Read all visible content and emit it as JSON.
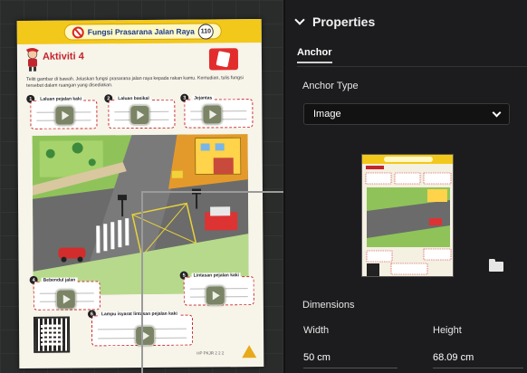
{
  "worksheet": {
    "header_title": "Fungsi Prasarana Jalan Raya",
    "page_number": "110",
    "activity_title": "Aktiviti 4",
    "instructions": "Teliti gambar di bawah. Jelaskan fungsi prasarana jalan raya kepada rakan kamu. Kemudian, tulis fungsi tersebut dalam ruangan yang disediakan.",
    "boxes": [
      {
        "num": "1",
        "label": "Laluan pejalan kaki"
      },
      {
        "num": "2",
        "label": "Laluan basikal"
      },
      {
        "num": "3",
        "label": "Jejantas"
      },
      {
        "num": "4",
        "label": "Bebendul jalan"
      },
      {
        "num": "5",
        "label": "Lintasan pejalan kaki"
      },
      {
        "num": "6",
        "label": "Lampu isyarat lintasan pejalan kaki"
      }
    ],
    "footer_tag": "HP PKJR 2 2 2"
  },
  "panel": {
    "title": "Properties",
    "section": "Anchor",
    "anchor_type_label": "Anchor Type",
    "anchor_type_value": "Image",
    "dimensions_label": "Dimensions",
    "width_label": "Width",
    "width_value": "50 cm",
    "height_label": "Height",
    "height_value": "68.09 cm"
  },
  "colors": {
    "header_yellow": "#f2c81b",
    "accent_red": "#c4242b",
    "panel_bg": "#1c1c1e"
  }
}
